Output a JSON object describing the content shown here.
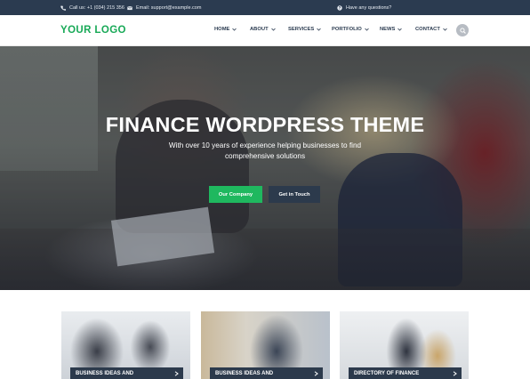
{
  "colors": {
    "topbar": "#2b3b50",
    "brand_green": "#18a957",
    "button_green": "#1fb85f",
    "button_dark": "#2c3a4c",
    "nav_text": "#2b3b50"
  },
  "topbar": {
    "phone": {
      "icon": "phone-icon",
      "text": "Call us: +1 (034) 215 356"
    },
    "email": {
      "icon": "email-icon",
      "text": "Email: support@example.com"
    },
    "question": {
      "icon": "question-icon",
      "text": "Have any questions?"
    }
  },
  "header": {
    "logo": "YOUR LOGO",
    "nav": [
      {
        "label": "HOME",
        "icon": "chevron-down-icon"
      },
      {
        "label": "ABOUT",
        "icon": "chevron-down-icon"
      },
      {
        "label": "SERVICES",
        "icon": "chevron-down-icon"
      },
      {
        "label": "PORTFOLIO",
        "icon": "chevron-down-icon"
      },
      {
        "label": "NEWS",
        "icon": "chevron-down-icon"
      },
      {
        "label": "CONTACT",
        "icon": "chevron-down-icon"
      }
    ],
    "search_icon": "search-icon"
  },
  "hero": {
    "title": "FINANCE WORDPRESS THEME",
    "subtitle_line1": "With over 10 years of experience helping businesses to find",
    "subtitle_line2": "comprehensive solutions",
    "primary_button": "Our Company",
    "secondary_button": "Get in Touch"
  },
  "cards": [
    {
      "label": "BUSINESS IDEAS AND",
      "icon": "chevron-right-icon"
    },
    {
      "label": "BUSINESS IDEAS AND",
      "icon": "chevron-right-icon"
    },
    {
      "label": "DIRECTORY OF FINANCE",
      "icon": "chevron-right-icon"
    }
  ]
}
